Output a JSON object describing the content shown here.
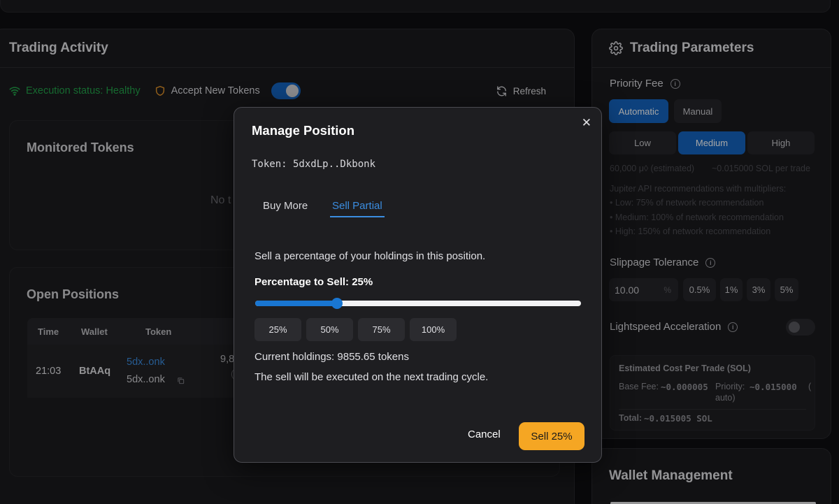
{
  "activity": {
    "title": "Trading Activity",
    "execution_status": "Execution status: Healthy",
    "accept_new_tokens": "Accept New Tokens",
    "refresh": "Refresh",
    "monitored_title": "Monitored Tokens",
    "no_tokens_partial": "No t",
    "open_positions_title": "Open Positions",
    "columns": [
      "Time",
      "Wallet",
      "Token"
    ],
    "row": {
      "time": "21:03",
      "wallet": "BtAAq",
      "token_link": "5dx..onk",
      "token_sub": "5dx..onk",
      "amount_partial": "9,8",
      "amount_sub_partial": "("
    }
  },
  "params": {
    "title": "Trading Parameters",
    "priority_fee": "Priority Fee",
    "mode_automatic": "Automatic",
    "mode_manual": "Manual",
    "level_low": "Low",
    "level_medium": "Medium",
    "level_high": "High",
    "estimate_micro": "60,000 μ◊ (estimated)",
    "estimate_sol": "~0.015000 SOL per trade",
    "jupiter_intro": "Jupiter API recommendations with multipliers:",
    "jupiter_low": "• Low: 75% of network recommendation",
    "jupiter_medium": "• Medium: 100% of network recommendation",
    "jupiter_high": "• High: 150% of network recommendation",
    "slippage": "Slippage Tolerance",
    "slippage_value": "10.00",
    "slippage_unit": "%",
    "slip_opts": [
      "0.5%",
      "1%",
      "3%",
      "5%"
    ],
    "lightspeed": "Lightspeed Acceleration",
    "est_title": "Estimated Cost Per Trade (SOL)",
    "base_fee_label": "Base Fee:",
    "base_fee_value": "~0.000005",
    "priority_label": "Priority:",
    "priority_value": "~0.015000",
    "priority_paren": "(",
    "priority_auto": "auto)",
    "total_label": "Total:",
    "total_value": "~0.015005 SOL"
  },
  "wallet": {
    "title": "Wallet Management"
  },
  "modal": {
    "title": "Manage Position",
    "close": "✕",
    "token_line": "Token: 5dxdLp..Dkbonk",
    "tab_buy": "Buy More",
    "tab_sell": "Sell Partial",
    "description": "Sell a percentage of your holdings in this position.",
    "percentage_label": "Percentage to Sell: 25%",
    "slider_value": 25,
    "pct_options": [
      "25%",
      "50%",
      "75%",
      "100%"
    ],
    "holdings": "Current holdings: 9855.65 tokens",
    "note": "The sell will be executed on the next trading cycle.",
    "cancel": "Cancel",
    "sell": "Sell 25%"
  },
  "colors": {
    "accent_blue": "#1565c0",
    "sell_orange": "#f5a623",
    "healthy_green": "#22a34a",
    "link_blue": "#3b8de0"
  }
}
